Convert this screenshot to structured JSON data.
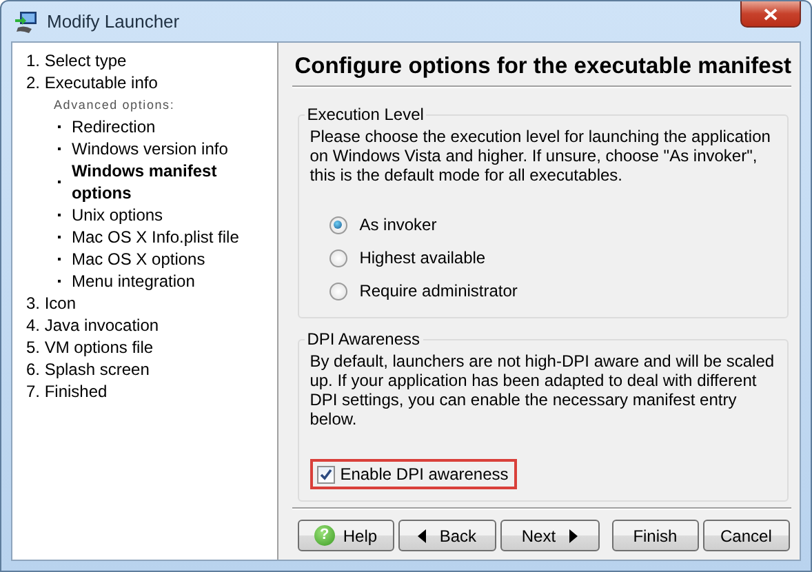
{
  "window": {
    "title": "Modify Launcher"
  },
  "sidebar": {
    "steps": [
      {
        "label": "1. Select type",
        "selected": false
      },
      {
        "label": "2. Executable info",
        "selected": false,
        "subheading": "Advanced options:",
        "children": [
          {
            "label": "Redirection",
            "selected": false
          },
          {
            "label": "Windows version info",
            "selected": false
          },
          {
            "label": "Windows manifest options",
            "selected": true
          },
          {
            "label": "Unix options",
            "selected": false
          },
          {
            "label": "Mac OS X Info.plist file",
            "selected": false
          },
          {
            "label": "Mac OS X options",
            "selected": false
          },
          {
            "label": "Menu integration",
            "selected": false
          }
        ]
      },
      {
        "label": "3. Icon",
        "selected": false
      },
      {
        "label": "4. Java invocation",
        "selected": false
      },
      {
        "label": "5. VM options file",
        "selected": false
      },
      {
        "label": "6. Splash screen",
        "selected": false
      },
      {
        "label": "7. Finished",
        "selected": false
      }
    ]
  },
  "page": {
    "title": "Configure options for the executable manifest",
    "execution_level": {
      "legend": "Execution Level",
      "description": "Please choose the execution level for launching the application on Windows Vista and higher. If unsure, choose \"As invoker\", this is the default mode for all executables.",
      "options": [
        {
          "label": "As invoker",
          "selected": true
        },
        {
          "label": "Highest available",
          "selected": false
        },
        {
          "label": "Require administrator",
          "selected": false
        }
      ]
    },
    "dpi_awareness": {
      "legend": "DPI Awareness",
      "description": "By default, launchers are not high-DPI aware and will be scaled up. If your application has been adapted to deal with different DPI settings, you can enable the necessary manifest entry below.",
      "checkbox": {
        "label": "Enable DPI awareness",
        "checked": true,
        "highlighted": true
      }
    }
  },
  "buttons": [
    {
      "label": "Help",
      "kind": "help",
      "icon_text": "?"
    },
    {
      "label": "Back",
      "kind": "back"
    },
    {
      "label": "Next",
      "kind": "next"
    },
    {
      "label": "Finish",
      "kind": "plain"
    },
    {
      "label": "Cancel",
      "kind": "plain"
    }
  ]
}
